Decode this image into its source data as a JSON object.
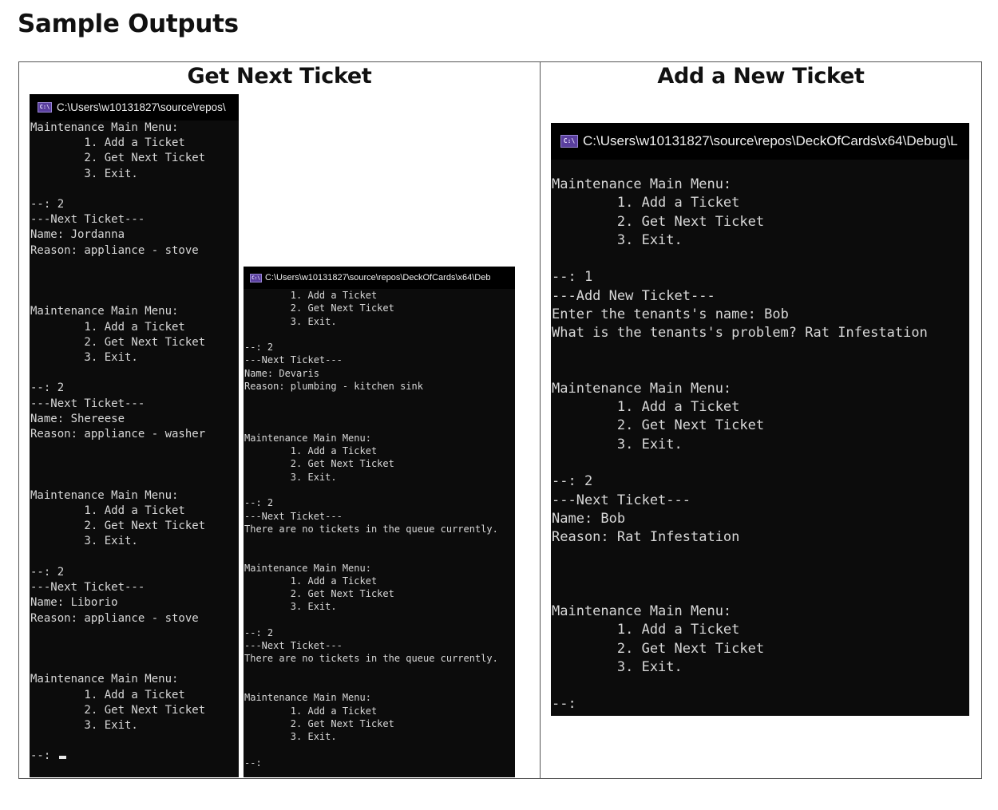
{
  "page": {
    "heading": "Sample Outputs",
    "columns": {
      "left_title": "Get Next Ticket",
      "right_title": "Add a New Ticket"
    }
  },
  "icon": {
    "cmd_glyph": "C:\\"
  },
  "consoles": {
    "c1": {
      "title": "C:\\Users\\w10131827\\source\\repos\\",
      "text": "Maintenance Main Menu:\n        1. Add a Ticket\n        2. Get Next Ticket\n        3. Exit.\n\n--: 2\n---Next Ticket---\nName: Jordanna\nReason: appliance - stove\n\n\n\nMaintenance Main Menu:\n        1. Add a Ticket\n        2. Get Next Ticket\n        3. Exit.\n\n--: 2\n---Next Ticket---\nName: Shereese\nReason: appliance - washer\n\n\n\nMaintenance Main Menu:\n        1. Add a Ticket\n        2. Get Next Ticket\n        3. Exit.\n\n--: 2\n---Next Ticket---\nName: Liborio\nReason: appliance - stove\n\n\n\nMaintenance Main Menu:\n        1. Add a Ticket\n        2. Get Next Ticket\n        3. Exit.\n\n--: "
    },
    "c2": {
      "title": "C:\\Users\\w10131827\\source\\repos\\DeckOfCards\\x64\\Deb",
      "text": "        1. Add a Ticket\n        2. Get Next Ticket\n        3. Exit.\n\n--: 2\n---Next Ticket---\nName: Devaris\nReason: plumbing - kitchen sink\n\n\n\nMaintenance Main Menu:\n        1. Add a Ticket\n        2. Get Next Ticket\n        3. Exit.\n\n--: 2\n---Next Ticket---\nThere are no tickets in the queue currently.\n\n\nMaintenance Main Menu:\n        1. Add a Ticket\n        2. Get Next Ticket\n        3. Exit.\n\n--: 2\n---Next Ticket---\nThere are no tickets in the queue currently.\n\n\nMaintenance Main Menu:\n        1. Add a Ticket\n        2. Get Next Ticket\n        3. Exit.\n\n--:"
    },
    "c3": {
      "title": "C:\\Users\\w10131827\\source\\repos\\DeckOfCards\\x64\\Debug\\L",
      "text": "Maintenance Main Menu:\n        1. Add a Ticket\n        2. Get Next Ticket\n        3. Exit.\n\n--: 1\n---Add New Ticket---\nEnter the tenants's name: Bob\nWhat is the tenants's problem? Rat Infestation\n\n\nMaintenance Main Menu:\n        1. Add a Ticket\n        2. Get Next Ticket\n        3. Exit.\n\n--: 2\n---Next Ticket---\nName: Bob\nReason: Rat Infestation\n\n\n\nMaintenance Main Menu:\n        1. Add a Ticket\n        2. Get Next Ticket\n        3. Exit.\n\n--:"
    }
  }
}
